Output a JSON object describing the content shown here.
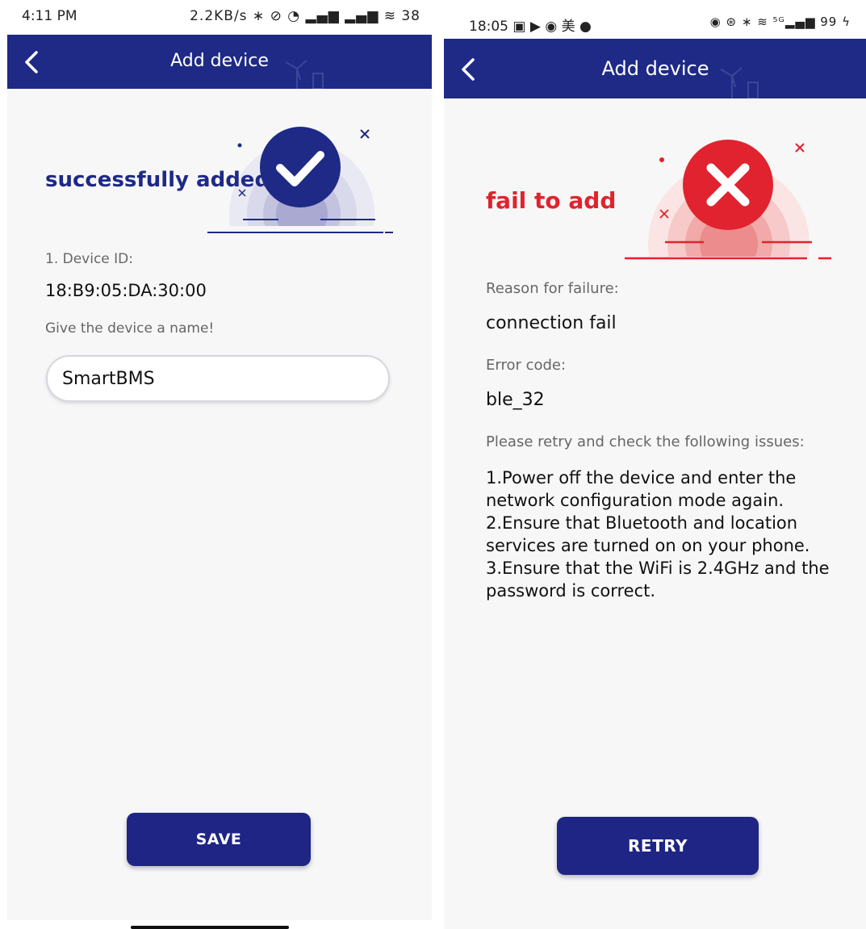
{
  "left_screen": {
    "status_bar": {
      "time": "4:11 PM",
      "icons_text": "2.2KB/s ∗ ⊘ ◔ ▂▄▆ ▂▄▆ ≋ 38"
    },
    "app_bar": {
      "title": "Add device"
    },
    "result_message": "successfully added",
    "device_id_label": "1. Device ID:",
    "device_id_value": "18:B9:05:DA:30:00",
    "name_prompt": "Give the device a name!",
    "name_input_value": "SmartBMS",
    "save_button": "SAVE",
    "accent_color": "#1e2a86"
  },
  "right_screen": {
    "status_bar": {
      "time": "18:05 ▣ ▶ ◉ 美 ●",
      "icons_text": "◉ ⊛ ∗ ≋ ⁵ᴳ▂▄▆ 99 ϟ"
    },
    "app_bar": {
      "title": "Add device"
    },
    "result_message": "fail to add",
    "reason_label": "Reason for failure:",
    "reason_value": "connection fail",
    "error_code_label": "Error code:",
    "error_code_value": "ble_32",
    "retry_prompt": "Please retry and check the following issues:",
    "issues": [
      "1.Power off the device and enter the network configuration mode again.",
      "2.Ensure that Bluetooth and location services are turned on on your phone.",
      "3.Ensure that the WiFi is 2.4GHz and the password is correct."
    ],
    "retry_button": "RETRY",
    "error_color": "#e0232e"
  }
}
